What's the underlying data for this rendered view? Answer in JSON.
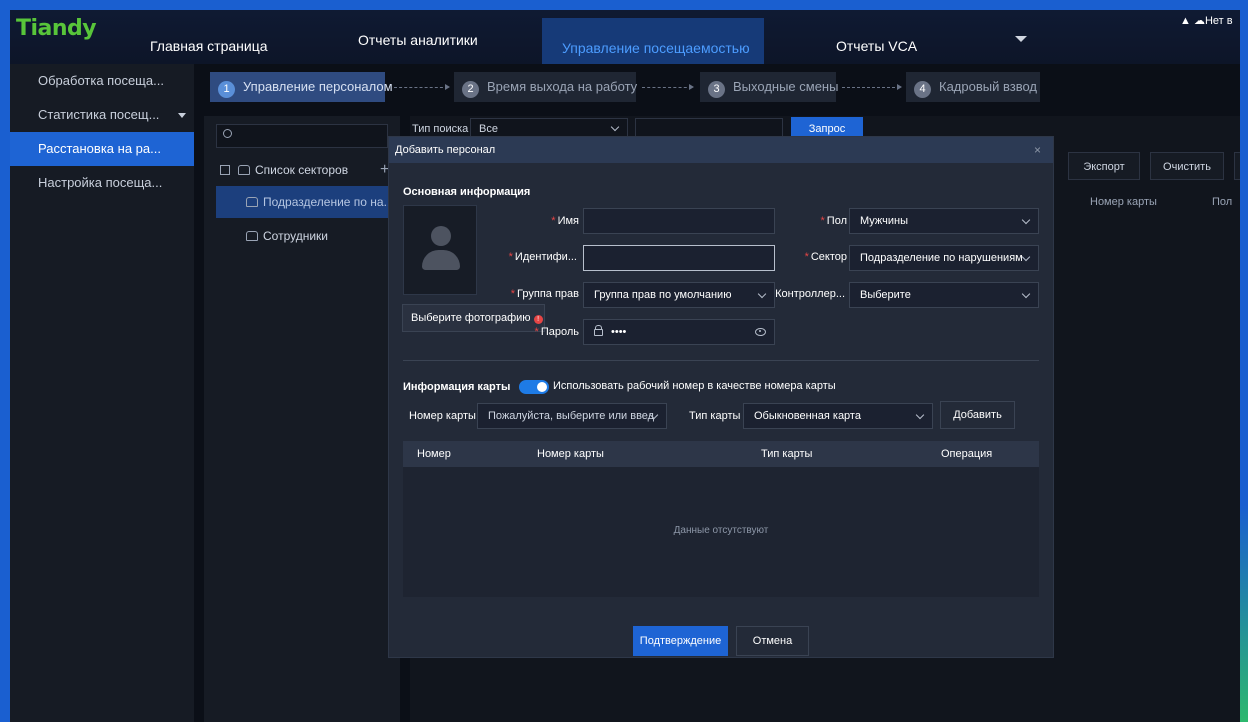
{
  "app": {
    "logo": "Tiandy",
    "notification": "Нет в"
  },
  "nav": {
    "items": [
      "Главная страница",
      "Отчеты аналитики",
      "Управление посещаемостью",
      "Отчеты VCA"
    ],
    "active": "Управление посещаемостью"
  },
  "sidebar": {
    "items": [
      {
        "label": "Обработка посеща..."
      },
      {
        "label": "Статистика посещ..."
      },
      {
        "label": "Расстановка на ра..."
      },
      {
        "label": "Настройка посеща..."
      }
    ]
  },
  "steps": [
    {
      "num": "1",
      "label": "Управление персоналом"
    },
    {
      "num": "2",
      "label": "Время выхода на работу"
    },
    {
      "num": "3",
      "label": "Выходные смены"
    },
    {
      "num": "4",
      "label": "Кадровый взвод"
    }
  ],
  "tree": {
    "root": "Список секторов",
    "items": [
      "Подразделение по на...",
      "Сотрудники"
    ]
  },
  "filter": {
    "label": "Тип поиска",
    "value": "Все",
    "query_button": "Запрос"
  },
  "actions": {
    "export": "Экспорт",
    "clear": "Очистить"
  },
  "table_right": {
    "col_card": "Номер карты",
    "col_extra": "Пол"
  },
  "modal": {
    "title": "Добавить персонал",
    "close": "×",
    "basic_section": "Основная информация",
    "photo_button": "Выберите фотографию",
    "fields": {
      "name_label": "Имя",
      "id_label": "Идентифи...",
      "group_label": "Группа прав",
      "group_value": "Группа прав по умолчанию",
      "password_label": "Пароль",
      "password_value": "••••",
      "gender_label": "Пол",
      "gender_value": "Мужчины",
      "sector_label": "Сектор",
      "sector_value": "Подразделение по нарушениям",
      "controller_label": "Контроллер...",
      "controller_value": "Выберите"
    },
    "card_section": "Информация карты",
    "toggle_label": "Использовать рабочий номер в качестве номера карты",
    "card_number_label": "Номер карты",
    "card_number_placeholder": "Пожалуйста, выберите или введ",
    "card_type_label": "Тип карты",
    "card_type_value": "Обыкновенная карта",
    "add_button": "Добавить",
    "columns": [
      "Номер",
      "Номер карты",
      "Тип карты",
      "Операция"
    ],
    "empty_text": "Данные отсутствуют",
    "confirm": "Подтверждение",
    "cancel": "Отмена"
  }
}
